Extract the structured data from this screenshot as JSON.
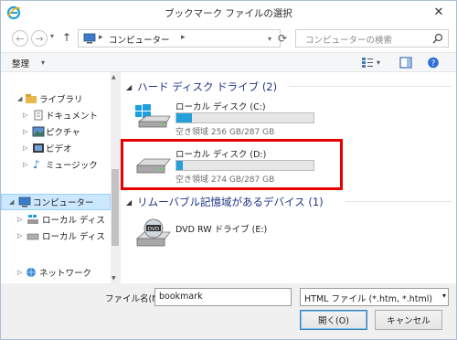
{
  "window": {
    "title": "ブックマーク ファイルの選択"
  },
  "nav": {
    "address": "コンピューター",
    "address_sep": "▸",
    "search_placeholder": "コンピューターの検索"
  },
  "toolbar": {
    "organize_label": "整理"
  },
  "sidebar": {
    "items": [
      {
        "label": "ライブラリ"
      },
      {
        "label": "ドキュメント"
      },
      {
        "label": "ピクチャ"
      },
      {
        "label": "ビデオ"
      },
      {
        "label": "ミュージック"
      },
      {
        "label": "コンピューター"
      },
      {
        "label": "ローカル ディス"
      },
      {
        "label": "ローカル ディス"
      },
      {
        "label": "ネットワーク"
      }
    ]
  },
  "content": {
    "groups": [
      {
        "title": "ハード ディスク ドライブ (2)"
      },
      {
        "title": "リムーバブル記憶域があるデバイス (1)"
      }
    ],
    "drives": [
      {
        "name": "ローカル ディスク (C:)",
        "free_text": "空き領域 256 GB/287 GB",
        "used_fraction": 0.11
      },
      {
        "name": "ローカル ディスク (D:)",
        "free_text": "空き領域 274 GB/287 GB",
        "used_fraction": 0.045
      },
      {
        "name": "DVD RW ドライブ (E:)"
      }
    ]
  },
  "footer": {
    "filename_label": "ファイル名(N):",
    "filename_value": "bookmark",
    "filetype_value": "HTML ファイル (*.htm, *.html)",
    "open_label": "開く(O)",
    "cancel_label": "キャンセル"
  },
  "colors": {
    "accent": "#26a0da",
    "highlight": "#e60000",
    "group_header": "#1e3287",
    "selection": "#cce8ff"
  }
}
